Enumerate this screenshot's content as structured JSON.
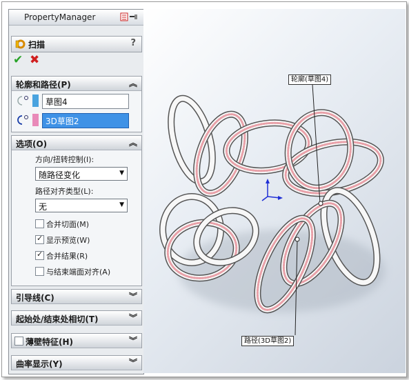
{
  "property_manager": {
    "title": "PropertyManager",
    "feature_name": "扫描",
    "help": "?",
    "ok_symbol": "✔",
    "cancel_symbol": "✖"
  },
  "profile_path": {
    "header": "轮廓和路径(P)",
    "profile_value": "草图4",
    "path_value": "3D草图2"
  },
  "options": {
    "header": "选项(O)",
    "orientation_label": "方向/扭转控制(I):",
    "orientation_value": "随路径变化",
    "path_align_label": "路径对齐类型(L):",
    "path_align_value": "无",
    "merge_tangent_faces": "合并切面(M)",
    "show_preview": "显示预览(W)",
    "merge_result": "合并结果(R)",
    "align_end_faces": "与结束端面对齐(A)",
    "merge_tangent_checked": false,
    "show_preview_checked": true,
    "merge_result_checked": true,
    "align_end_checked": false
  },
  "guide_curves": {
    "header": "引导线(C)"
  },
  "start_end_tangency": {
    "header": "起始处/结束处相切(T)"
  },
  "thin_feature": {
    "header": "薄壁特征(H)"
  },
  "curvature_display": {
    "header": "曲率显示(Y)"
  },
  "viewport": {
    "callout_profile": "轮廓(草图4)",
    "callout_path": "路径(3D草图2)"
  },
  "colors": {
    "selection_blue": "#3f92e6",
    "profile_swatch": "#4aa3df",
    "path_swatch": "#e98ab9",
    "preview_pink": "#e8a0a8"
  }
}
